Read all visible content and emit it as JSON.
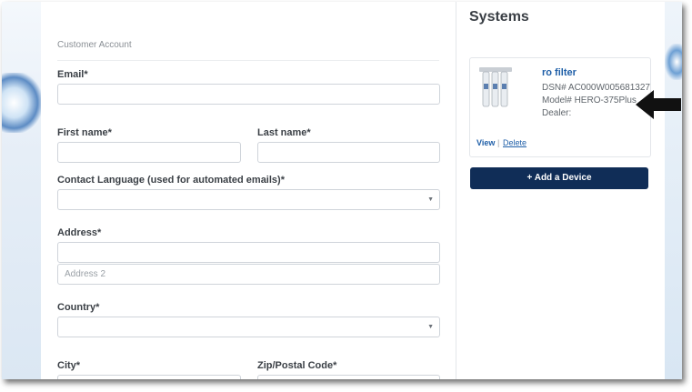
{
  "form": {
    "section_label": "Customer Account",
    "email_label": "Email*",
    "first_name_label": "First name*",
    "last_name_label": "Last name*",
    "language_label": "Contact Language (used for automated emails)*",
    "address_label": "Address*",
    "address2_placeholder": "Address 2",
    "country_label": "Country*",
    "city_label": "City*",
    "zip_label": "Zip/Postal Code*"
  },
  "systems": {
    "title": "Systems",
    "device": {
      "name": "ro filter",
      "dsn": "DSN# AC000W005681327",
      "model": "Model# HERO-375Plus",
      "dealer": "Dealer:",
      "view_label": "View",
      "separator": "|",
      "delete_label": "Delete"
    },
    "add_button_label": "+ Add a Device"
  },
  "colors": {
    "accent": "#102d57",
    "link": "#1f5fa8"
  },
  "icons": {
    "select_caret": "chevron-down-icon",
    "annotation": "arrow-left-icon"
  }
}
